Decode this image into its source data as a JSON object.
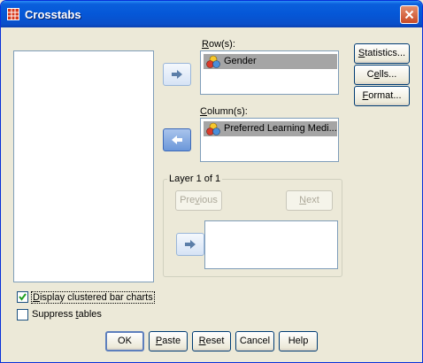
{
  "window": {
    "title": "Crosstabs",
    "close_label": "X"
  },
  "rows": {
    "label_u": "R",
    "label_rest": "ow(s):",
    "items": [
      "Gender"
    ]
  },
  "columns": {
    "label_u": "C",
    "label_rest": "olumn(s):",
    "items": [
      "Preferred Learning Medi..."
    ]
  },
  "layer": {
    "label": "Layer 1 of 1",
    "previous": {
      "before": "Pre",
      "u": "v",
      "after": "ious"
    },
    "next": {
      "before": "",
      "u": "N",
      "after": "ext"
    }
  },
  "side_buttons": {
    "statistics": {
      "before": "",
      "u": "S",
      "after": "tatistics..."
    },
    "cells": {
      "before": "C",
      "u": "e",
      "after": "lls..."
    },
    "format": {
      "before": "",
      "u": "F",
      "after": "ormat..."
    }
  },
  "options": {
    "clustered": {
      "before": "",
      "u": "D",
      "after": "isplay clustered bar charts",
      "checked": true
    },
    "suppress": {
      "before": "Suppress ",
      "u": "t",
      "after": "ables",
      "checked": false
    }
  },
  "bottom_buttons": {
    "ok": "OK",
    "paste": {
      "before": "",
      "u": "P",
      "after": "aste"
    },
    "reset": {
      "before": "",
      "u": "R",
      "after": "eset"
    },
    "cancel": "Cancel",
    "help": "Help"
  },
  "colors": {
    "title_bar": "#0557d7",
    "dialog_bg": "#ece9d8",
    "selected_item": "#a5a5a5"
  }
}
